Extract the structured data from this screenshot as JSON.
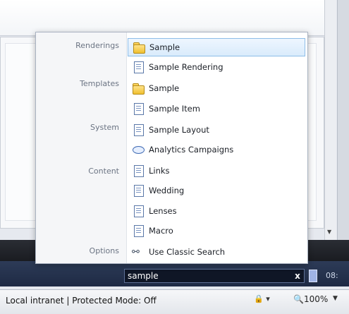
{
  "search": {
    "query": "sample",
    "clear_label": "x"
  },
  "taskbar": {
    "clock": "08:"
  },
  "status": {
    "zone_text": "Local intranet | Protected Mode: Off",
    "zoom": "100%",
    "zoom_icon": "magnifier-icon",
    "security_icon": "lock-icon"
  },
  "popup": {
    "categories": {
      "renderings": "Renderings",
      "templates": "Templates",
      "system": "System",
      "content": "Content",
      "options": "Options"
    },
    "items": [
      {
        "label": "Sample",
        "icon": "folder-icon",
        "selected": true
      },
      {
        "label": "Sample Rendering",
        "icon": "document-icon"
      },
      {
        "label": "Sample",
        "icon": "folder-icon"
      },
      {
        "label": "Sample Item",
        "icon": "document-icon"
      },
      {
        "label": "Sample Layout",
        "icon": "document-icon"
      },
      {
        "label": "Analytics Campaigns",
        "icon": "campaign-icon"
      },
      {
        "label": "Links",
        "icon": "document-icon"
      },
      {
        "label": "Wedding",
        "icon": "document-icon"
      },
      {
        "label": "Lenses",
        "icon": "document-icon"
      },
      {
        "label": "Macro",
        "icon": "document-icon"
      },
      {
        "label": "Use Classic Search",
        "icon": "classic-search-icon"
      }
    ]
  }
}
